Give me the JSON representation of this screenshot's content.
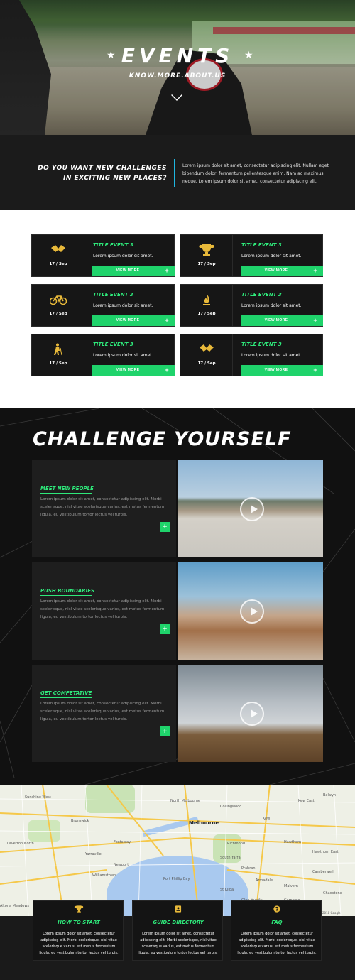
{
  "hero": {
    "title": "EVENTS",
    "subtitle": "KNOW.MORE.ABOUT.US",
    "star": "★",
    "chevron_icon": "chevron-down-icon"
  },
  "intro": {
    "question": "DO YOU WANT NEW CHALLENGES IN EXCITING NEW PLACES?",
    "text": "Lorem ipsum dolor sit amet, consectetur adipiscing elit. Nullam eget bibendum dolor, fermentum pellentesque enim. Nam ac maximus neque. Lorem ipsum dolor sit amet, consectetur adipiscing elit."
  },
  "events": [
    {
      "icon": "handshake-icon",
      "glyph": "✕",
      "date": "17 / Sep",
      "title": "TITLE EVENT 3",
      "desc": "Lorem ipsum dolor sit amet.",
      "button": "VIEW MORE"
    },
    {
      "icon": "trophy-icon",
      "glyph": "🏆",
      "date": "17 / Sep",
      "title": "TITLE EVENT 3",
      "desc": "Lorem ipsum dolor sit amet.",
      "button": "VIEW MORE"
    },
    {
      "icon": "bicycle-icon",
      "glyph": "🚲",
      "date": "17 / Sep",
      "title": "TITLE EVENT 3",
      "desc": "Lorem ipsum dolor sit amet.",
      "button": "VIEW MORE"
    },
    {
      "icon": "flame-icon",
      "glyph": "🔥",
      "date": "17 / Sep",
      "title": "TITLE EVENT 3",
      "desc": "Lorem ipsum dolor sit amet.",
      "button": "VIEW MORE"
    },
    {
      "icon": "hiker-icon",
      "glyph": "🚶",
      "date": "17 / Sep",
      "title": "TITLE EVENT 3",
      "desc": "Lorem ipsum dolor sit amet.",
      "button": "VIEW MORE"
    },
    {
      "icon": "handshake-icon",
      "glyph": "✕",
      "date": "17 / Sep",
      "title": "TITLE EVENT 3",
      "desc": "Lorem ipsum dolor sit amet.",
      "button": "VIEW MORE"
    }
  ],
  "button_plus": "+",
  "challenge": {
    "title": "CHALLENGE YOURSELF",
    "items": [
      {
        "heading": "MEET NEW PEOPLE",
        "text": "Lorem ipsum dolor sit amet, consectetur adipiscing elit. Morbi scelerisque, nisl vitae scelerisque varius, est metus fermentum ligula, eu vestibulum tortor lectus vel turpis.",
        "plus": "+"
      },
      {
        "heading": "PUSH BOUNDARIES",
        "text": "Lorem ipsum dolor sit amet, consectetur adipiscing elit. Morbi scelerisque, nisl vitae scelerisque varius, est metus fermentum ligula, eu vestibulum tortor lectus vel turpis.",
        "plus": "+"
      },
      {
        "heading": "GET COMPETATIVE",
        "text": "Lorem ipsum dolor sit amet, consectetur adipiscing elit. Morbi scelerisque, nisl vitae scelerisque varius, est metus fermentum ligula, eu vestibulum tortor lectus vel turpis.",
        "plus": "+"
      }
    ]
  },
  "map": {
    "labels": {
      "melbourne": "Melbourne",
      "north_melbourne": "North Melbourne",
      "collingwood": "Collingwood",
      "kew": "Kew",
      "hawthorn": "Hawthorn",
      "hawthorn_east": "Hawthorn East",
      "camberwell": "Camberwell",
      "kew_east": "Kew East",
      "balwyn": "Balwyn",
      "brunswick": "Brunswick",
      "sunshine_west": "Sunshine West",
      "footscray": "Footscray",
      "yarraville": "Yarraville",
      "newport": "Newport",
      "williamstown": "Williamstown",
      "altona_meadows": "Altona Meadows",
      "south_yarra": "South Yarra",
      "richmond": "Richmond",
      "prahran": "Prahran",
      "st_kilda": "St Kilda",
      "armadale": "Armadale",
      "malvern": "Malvern",
      "port_phillip": "Port Phillip Bay",
      "laverton": "Laverton North",
      "carnegie": "Carnegie",
      "glenhuntly": "Glen Huntly",
      "chadstone": "Chadstone",
      "footer": "Map data ©2018 Google"
    }
  },
  "footer": [
    {
      "icon": "trophy-icon",
      "glyph": "🏆",
      "heading": "HOW TO START",
      "text": "Lorem ipsum dolor sit amet, consectetur adipiscing elit. Morbi scelerisque, nisl vitae scelerisque varius, est metus fermentum ligula, eu vestibulum tortor lectus vel turpis."
    },
    {
      "icon": "address-book-icon",
      "glyph": "📇",
      "heading": "GUIDE DIRECTORY",
      "text": "Lorem ipsum dolor sit amet, consectetur adipiscing elit. Morbi scelerisque, nisl vitae scelerisque varius, est metus fermentum ligula, eu vestibulum tortor lectus vel turpis."
    },
    {
      "icon": "question-circle-icon",
      "glyph": "?",
      "heading": "FAQ",
      "text": "Lorem ipsum dolor sit amet, consectetur adipiscing elit. Morbi scelerisque, nisl vitae scelerisque varius, est metus fermentum ligula, eu vestibulum tortor lectus vel turpis."
    }
  ],
  "colors": {
    "accent_green": "#1fd36b",
    "title_green": "#2ee87a",
    "icon_gold": "#e8b93a",
    "divider_blue": "#1fb6e0",
    "dark_bg": "#1b1b1b"
  }
}
